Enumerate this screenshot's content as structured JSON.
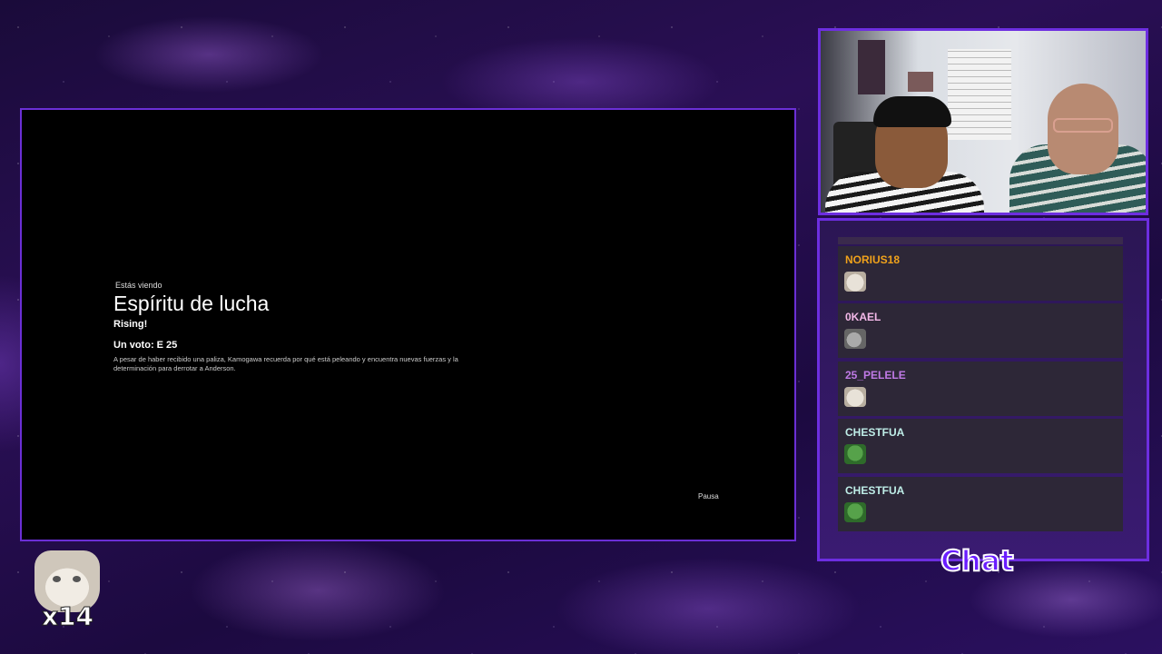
{
  "player": {
    "now_watching": "Estás viendo",
    "episode_title": "Espíritu de lucha",
    "show_title": "Rising!",
    "vote_line": "Un voto: E 25",
    "description": "A pesar de haber recibido una paliza, Kamogawa recuerda por qué está peleando y encuentra nuevas fuerzas y la determinación para derrotar a Anderson.",
    "status": "Pausa"
  },
  "chat": {
    "label": "Chat",
    "messages": [
      {
        "user": "NORIUS18",
        "color": "#f0a21b",
        "emote": "cat-emote"
      },
      {
        "user": "0KAEL",
        "color": "#f3b8e8",
        "emote": "rat-emote"
      },
      {
        "user": "25_PELELE",
        "color": "#c07ae6",
        "emote": "cat-emote"
      },
      {
        "user": "CHESTFUA",
        "color": "#bfeee8",
        "emote": "pepe-emote"
      },
      {
        "user": "CHESTFUA",
        "color": "#bfeee8",
        "emote": "pepe-emote"
      }
    ]
  },
  "overlay": {
    "emote_counter": "x14",
    "accent_color": "#6d2ee0"
  }
}
